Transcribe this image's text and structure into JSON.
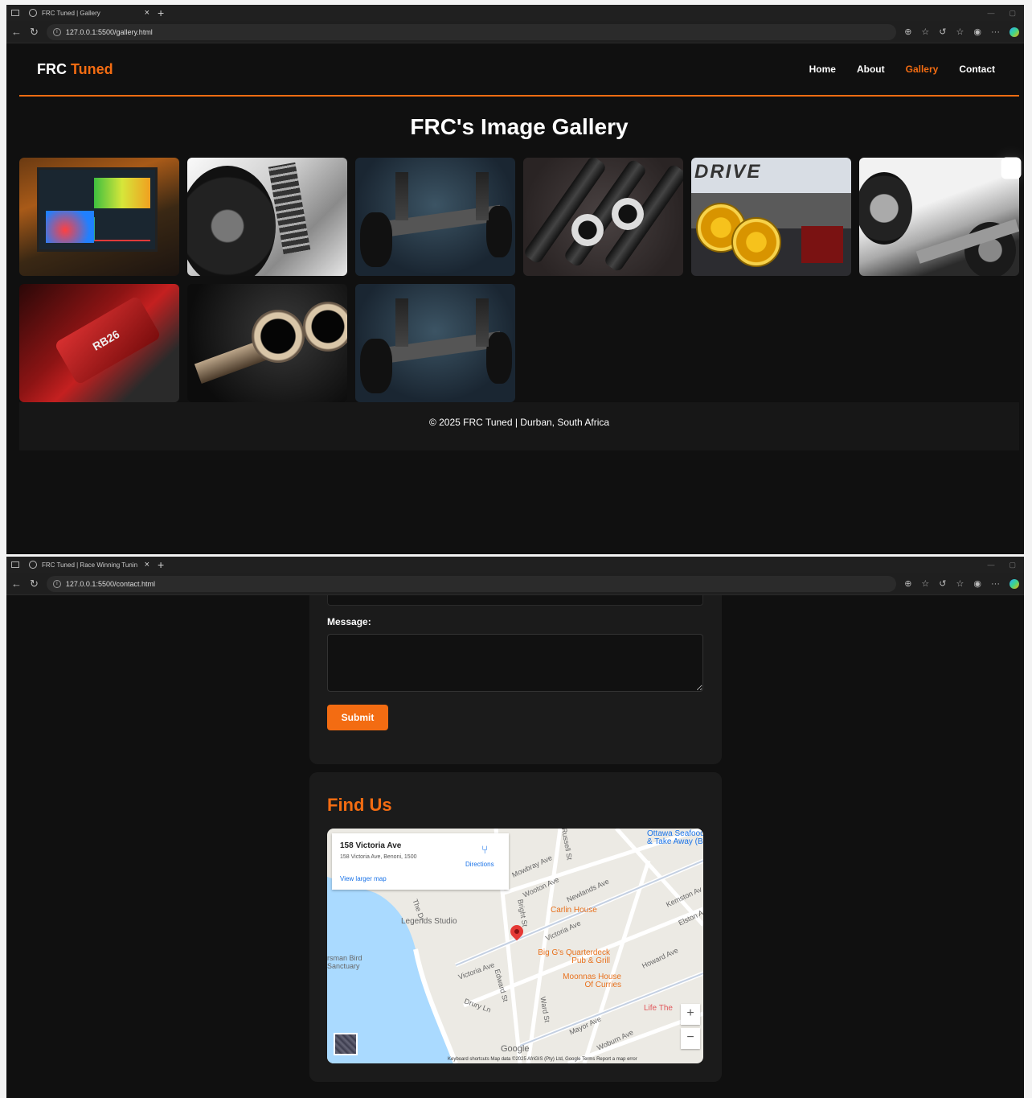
{
  "gallery_window": {
    "tab_title": "FRC Tuned | Gallery",
    "url": "127.0.0.1:5500/gallery.html",
    "brand": {
      "first": "FRC",
      "second": "Tuned"
    },
    "nav": [
      "Home",
      "About",
      "Gallery",
      "Contact"
    ],
    "active_nav": "Gallery",
    "heading": "FRC's Image Gallery",
    "footer": "© 2025 FRC Tuned | Durban, South Africa"
  },
  "contact_window": {
    "tab_title": "FRC Tuned | Race Winning Tunin",
    "url": "127.0.0.1:5500/contact.html",
    "message_label": "Message:",
    "submit_label": "Submit",
    "find_us_heading": "Find Us",
    "map": {
      "place_name": "158 Victoria Ave",
      "place_address": "158 Victoria Ave, Benoni, 1500",
      "directions": "Directions",
      "larger_map": "View larger map",
      "google": "Google",
      "attribution": "Keyboard shortcuts    Map data ©2025 AfriGIS (Pty) Ltd, Google    Terms    Report a map error",
      "streets": [
        "Mowbray Ave",
        "Wooton Ave",
        "Newlands Ave",
        "Victoria Ave",
        "Kemston Av",
        "Elston A",
        "Howard Ave",
        "Mayor Ave",
        "Woburn Ave",
        "Drury Ln",
        "Edward St",
        "Ward St",
        "Bright St",
        "Russell St",
        "The Dr",
        "Victoria Ave"
      ],
      "places": [
        "Legends Studio",
        "Carlin House",
        "Big G's Quarterdeck Pub & Grill",
        "Moonnas House Of Curries",
        "Ottawa Seafood & Take Away (B",
        "rsman Bird Sanctuary",
        "Life The"
      ]
    }
  }
}
